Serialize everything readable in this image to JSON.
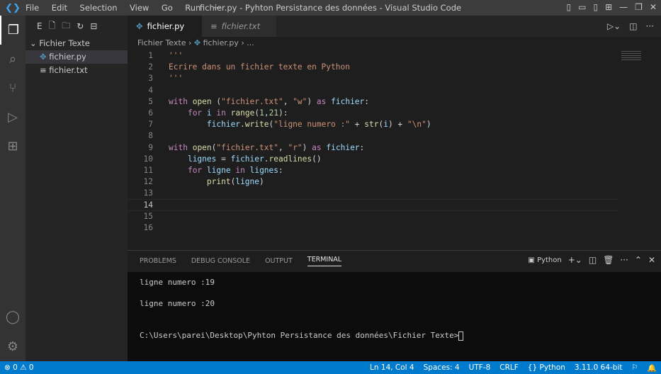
{
  "titlebar": {
    "menu": [
      "File",
      "Edit",
      "Selection",
      "View",
      "Go",
      "Run",
      "···"
    ],
    "title": "fichier.py - Pyhton Persistance des données - Visual Studio Code"
  },
  "sidebar": {
    "folder": "Fichier Texte",
    "files": [
      "fichier.py",
      "fichier.txt"
    ]
  },
  "tabs": [
    {
      "label": "fichier.py"
    },
    {
      "label": "fichier.txt"
    }
  ],
  "breadcrumb": {
    "folder": "Fichier Texte",
    "file": "fichier.py",
    "more": "..."
  },
  "code": {
    "line_numbers": [
      "1",
      "2",
      "3",
      "4",
      "5",
      "6",
      "7",
      "8",
      "9",
      "10",
      "11",
      "12",
      "13",
      "14",
      "15",
      "16"
    ]
  },
  "panel": {
    "tabs": [
      "PROBLEMS",
      "DEBUG CONSOLE",
      "OUTPUT",
      "TERMINAL"
    ],
    "shell": "Python",
    "terminal": [
      "ligne numero :19",
      "",
      "ligne numero :20",
      "",
      "",
      "C:\\Users\\parei\\Desktop\\Pyhton Persistance des données\\Fichier Texte>"
    ]
  },
  "status": {
    "errors": "0",
    "warnings": "0",
    "position": "Ln 14, Col 4",
    "spaces": "Spaces: 4",
    "encoding": "UTF-8",
    "eol": "CRLF",
    "language": "Python",
    "interpreter": "3.11.0 64-bit"
  }
}
